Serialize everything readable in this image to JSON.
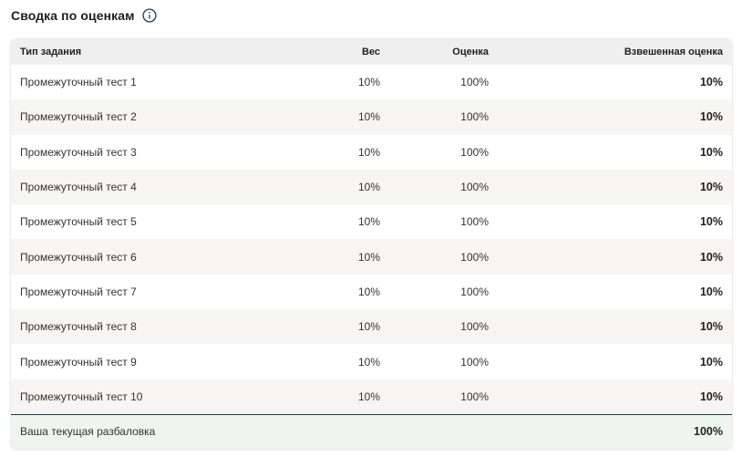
{
  "summary": {
    "title": "Сводка по оценкам",
    "info_icon": "info-circle-icon"
  },
  "table": {
    "headers": {
      "type": "Тип задания",
      "weight": "Вес",
      "score": "Оценка",
      "weighted": "Взвешенная оценка"
    },
    "rows": [
      {
        "type": "Промежуточный тест 1",
        "weight": "10%",
        "score": "100%",
        "weighted": "10%"
      },
      {
        "type": "Промежуточный тест 2",
        "weight": "10%",
        "score": "100%",
        "weighted": "10%"
      },
      {
        "type": "Промежуточный тест 3",
        "weight": "10%",
        "score": "100%",
        "weighted": "10%"
      },
      {
        "type": "Промежуточный тест 4",
        "weight": "10%",
        "score": "100%",
        "weighted": "10%"
      },
      {
        "type": "Промежуточный тест 5",
        "weight": "10%",
        "score": "100%",
        "weighted": "10%"
      },
      {
        "type": "Промежуточный тест 6",
        "weight": "10%",
        "score": "100%",
        "weighted": "10%"
      },
      {
        "type": "Промежуточный тест 7",
        "weight": "10%",
        "score": "100%",
        "weighted": "10%"
      },
      {
        "type": "Промежуточный тест 8",
        "weight": "10%",
        "score": "100%",
        "weighted": "10%"
      },
      {
        "type": "Промежуточный тест 9",
        "weight": "10%",
        "score": "100%",
        "weighted": "10%"
      },
      {
        "type": "Промежуточный тест 10",
        "weight": "10%",
        "score": "100%",
        "weighted": "10%"
      }
    ],
    "footer": {
      "label": "Ваша текущая разбаловка",
      "total": "100%"
    }
  },
  "colors": {
    "header_bg": "#efefef",
    "row_alt_bg": "#f6f5f3",
    "footer_bg": "#eef5f1",
    "footer_border": "#1f3a3a",
    "icon": "#1f3a5c"
  }
}
